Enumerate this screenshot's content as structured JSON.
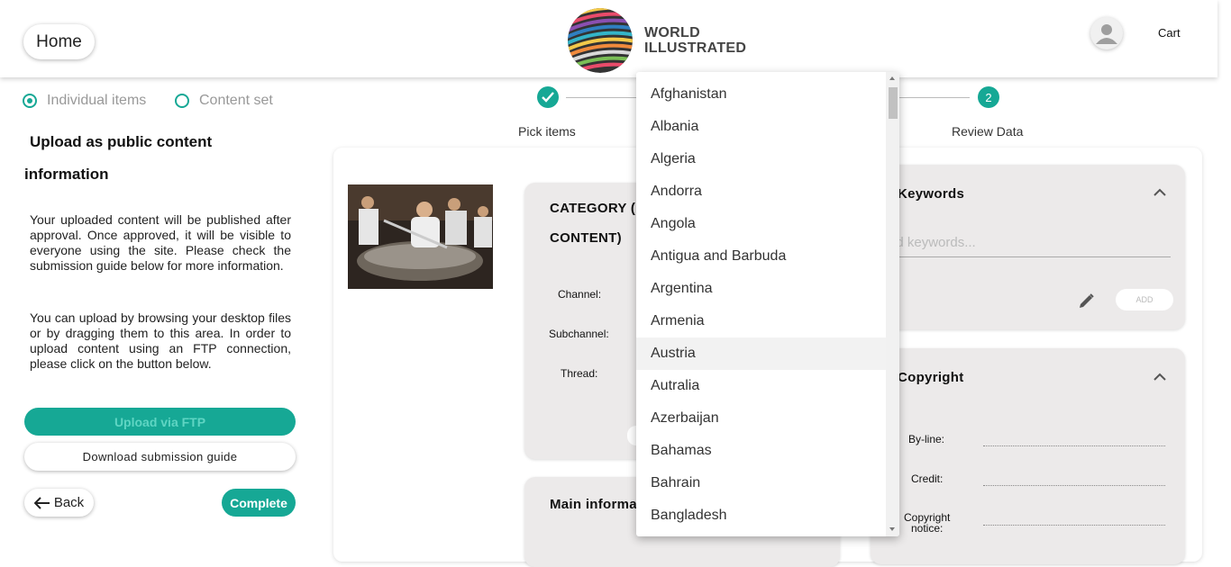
{
  "header": {
    "home_label": "Home",
    "logo_line1": "WORLD",
    "logo_line2": "ILLUSTRATED",
    "cart_label": "Cart"
  },
  "left_panel": {
    "radio_options": [
      {
        "label": "Individual items",
        "selected": true
      },
      {
        "label": "Content set",
        "selected": false
      }
    ],
    "title_line1": "Upload as public content",
    "title_line2": "information",
    "paragraph1": "Your uploaded content will be published after approval. Once approved, it will be visible to everyone using the site. Please check the submission guide below for more information.",
    "paragraph2": "You can upload by browsing your desktop files or by dragging them to this area. In order to upload content using an FTP connection, please click on the button below.",
    "ftp_button": "Upload via FTP",
    "guide_button": "Download submission guide",
    "back_button": "Back",
    "complete_button": "Complete"
  },
  "stepper": {
    "step1_label": "Pick items",
    "step2_number": "2",
    "step2_label": "Review Data"
  },
  "category_card": {
    "title_line1": "CATEGORY (",
    "title_line2": "CONTENT)",
    "channel_label": "Channel:",
    "subchannel_label": "Subchannel:",
    "thread_label": "Thread:"
  },
  "main_info_card": {
    "title": "Main informa"
  },
  "keywords_card": {
    "title": "Keywords",
    "placeholder": "dd keywords...",
    "add_button": "ADD"
  },
  "copyright_card": {
    "title": "Copyright",
    "byline_label": "By-line:",
    "credit_label": "Credit:",
    "notice_line1": "Copyright",
    "notice_line2": "notice:"
  },
  "dropdown": {
    "options": [
      "Afghanistan",
      "Albania",
      "Algeria",
      "Andorra",
      "Angola",
      "Antigua and Barbuda",
      "Argentina",
      "Armenia",
      "Austria",
      "Autralia",
      "Azerbaijan",
      "Bahamas",
      "Bahrain",
      "Bangladesh"
    ],
    "highlighted": "Austria"
  },
  "colors": {
    "accent": "#16a895",
    "card_gray": "#eceaea"
  }
}
